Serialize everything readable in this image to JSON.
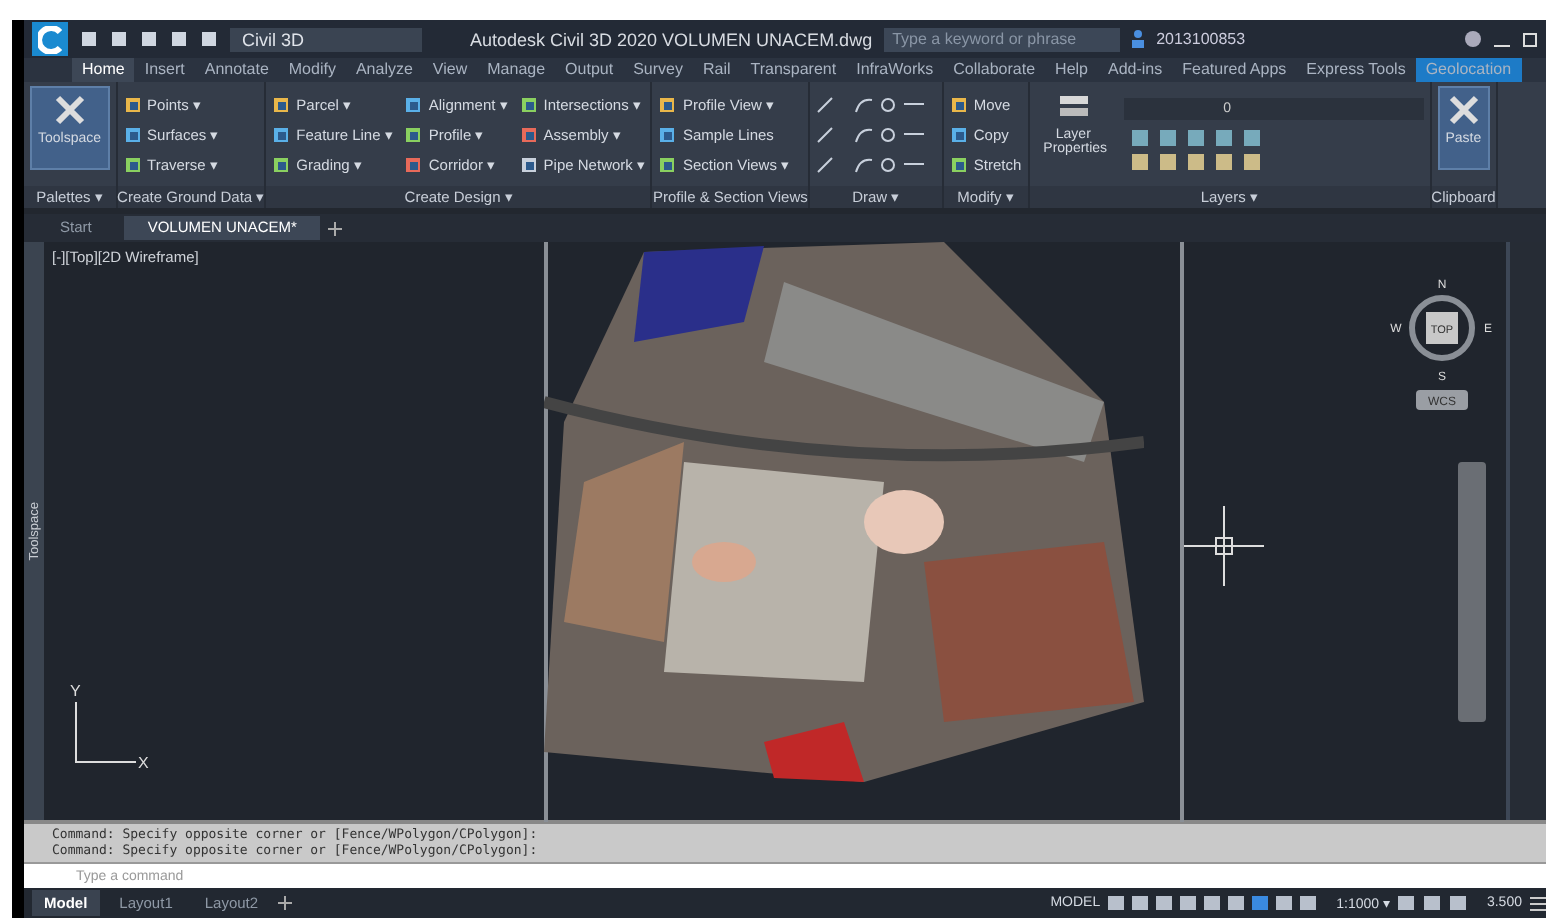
{
  "title_bar": {
    "workspace": "Civil 3D",
    "title": "Autodesk Civil 3D 2020  VOLUMEN UNACEM.dwg",
    "search": {
      "placeholder": "Type a keyword or phrase"
    },
    "user": "2013100853"
  },
  "ribbon_tabs": [
    {
      "label": "Home",
      "selected": true,
      "contextual": false
    },
    {
      "label": "Insert",
      "selected": false,
      "contextual": false
    },
    {
      "label": "Annotate",
      "selected": false,
      "contextual": false
    },
    {
      "label": "Modify",
      "selected": false,
      "contextual": false
    },
    {
      "label": "Analyze",
      "selected": false,
      "contextual": false
    },
    {
      "label": "View",
      "selected": false,
      "contextual": false
    },
    {
      "label": "Manage",
      "selected": false,
      "contextual": false
    },
    {
      "label": "Output",
      "selected": false,
      "contextual": false
    },
    {
      "label": "Survey",
      "selected": false,
      "contextual": false
    },
    {
      "label": "Rail",
      "selected": false,
      "contextual": false
    },
    {
      "label": "Transparent",
      "selected": false,
      "contextual": false
    },
    {
      "label": "InfraWorks",
      "selected": false,
      "contextual": false
    },
    {
      "label": "Collaborate",
      "selected": false,
      "contextual": false
    },
    {
      "label": "Help",
      "selected": false,
      "contextual": false
    },
    {
      "label": "Add-ins",
      "selected": false,
      "contextual": false
    },
    {
      "label": "Featured Apps",
      "selected": false,
      "contextual": false
    },
    {
      "label": "Express Tools",
      "selected": false,
      "contextual": false
    },
    {
      "label": "Geolocation",
      "selected": false,
      "contextual": true
    }
  ],
  "ribbon_panels": [
    {
      "title": "Palettes ▾",
      "kind": "big",
      "tools": [
        {
          "label": "Toolspace"
        }
      ]
    },
    {
      "title": "Create Ground Data ▾",
      "kind": "columns",
      "columns": [
        [
          "Points ▾",
          "Surfaces ▾",
          "Traverse ▾"
        ]
      ]
    },
    {
      "title": "Create Design ▾",
      "kind": "columns",
      "columns": [
        [
          "Parcel ▾",
          "Feature Line ▾",
          "Grading ▾"
        ],
        [
          "Alignment ▾",
          "Profile ▾",
          "Corridor ▾"
        ],
        [
          "Intersections ▾",
          "Assembly ▾",
          "Pipe Network ▾"
        ]
      ]
    },
    {
      "title": "Profile & Section Views",
      "kind": "columns",
      "columns": [
        [
          "Profile View ▾",
          "Sample Lines",
          "Section Views ▾"
        ]
      ]
    },
    {
      "title": "Draw ▾",
      "kind": "icons"
    },
    {
      "title": "Modify ▾",
      "kind": "columns",
      "columns": [
        [
          "Move",
          "Copy",
          "Stretch"
        ]
      ]
    },
    {
      "title": "Layers ▾",
      "kind": "layers",
      "tools": [
        {
          "label": "Layer Properties"
        }
      ],
      "layer": "0"
    },
    {
      "title": "Clipboard",
      "kind": "big",
      "tools": [
        {
          "label": "Paste"
        }
      ]
    }
  ],
  "doc_tabs": [
    {
      "label": "Start",
      "selected": false
    },
    {
      "label": "VOLUMEN UNACEM*",
      "selected": true
    }
  ],
  "viewport": {
    "label": "[-][Top][2D Wireframe]",
    "side_palette": "Toolspace",
    "viewcube": {
      "face": "TOP",
      "north": "N",
      "south": "S",
      "east": "E",
      "west": "W",
      "ucs": "WCS"
    },
    "axis_y": "Y",
    "axis_x": "X"
  },
  "command_history": [
    "Command: Specify opposite corner or [Fence/WPolygon/CPolygon]:",
    "Command: Specify opposite corner or [Fence/WPolygon/CPolygon]:"
  ],
  "command_line": {
    "placeholder": "Type a command"
  },
  "layout_tabs": [
    {
      "label": "Model",
      "selected": true
    },
    {
      "label": "Layout1",
      "selected": false
    },
    {
      "label": "Layout2",
      "selected": false
    }
  ],
  "status_bar": {
    "space": "MODEL",
    "scale": "1:1000 ▾",
    "value": "3.500"
  }
}
